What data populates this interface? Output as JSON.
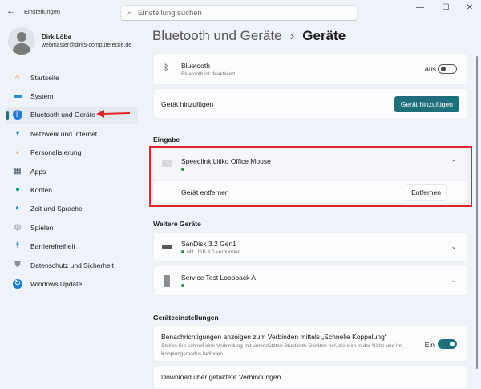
{
  "app": {
    "title": "Einstellungen",
    "back_icon": "arrow-left"
  },
  "search": {
    "placeholder": "Einstellung suchen"
  },
  "window_controls": {
    "minimize": "—",
    "maximize": "☐",
    "close": "✕"
  },
  "user": {
    "name": "Dirk Löbe",
    "email": "webmaster@dirks-computerecke.de"
  },
  "sidebar": {
    "items": [
      {
        "label": "Startseite",
        "icon": "home-icon"
      },
      {
        "label": "System",
        "icon": "system-icon"
      },
      {
        "label": "Bluetooth und Geräte",
        "icon": "bluetooth-icon",
        "active": true
      },
      {
        "label": "Netzwerk und Internet",
        "icon": "wifi-icon"
      },
      {
        "label": "Personalisierung",
        "icon": "brush-icon"
      },
      {
        "label": "Apps",
        "icon": "apps-icon"
      },
      {
        "label": "Konten",
        "icon": "account-icon"
      },
      {
        "label": "Zeit und Sprache",
        "icon": "clock-globe-icon"
      },
      {
        "label": "Spielen",
        "icon": "gamepad-icon"
      },
      {
        "label": "Barrierefreiheit",
        "icon": "accessibility-icon"
      },
      {
        "label": "Datenschutz und Sicherheit",
        "icon": "shield-icon"
      },
      {
        "label": "Windows Update",
        "icon": "update-icon"
      }
    ]
  },
  "breadcrumb": {
    "parent": "Bluetooth und Geräte",
    "sep": "›",
    "current": "Geräte"
  },
  "bluetooth": {
    "title": "Bluetooth",
    "subtitle": "Bluetooth ist deaktiviert.",
    "state": "Aus",
    "on": false
  },
  "add_device": {
    "label": "Gerät hinzufügen",
    "button": "Gerät hinzufügen"
  },
  "input_section": {
    "heading": "Eingabe",
    "device": "Speedlink Litiko Office Mouse",
    "remove_label": "Gerät entfernen",
    "remove_button": "Entfernen"
  },
  "other_section": {
    "heading": "Weitere Geräte",
    "devices": [
      {
        "name": "SanDisk 3.2 Gen1",
        "status": "Mit USB 3.0 verbunden"
      },
      {
        "name": "Service Test Loopback A",
        "status": ""
      }
    ]
  },
  "settings_section": {
    "heading": "Geräteeinstellungen",
    "swift_pair": {
      "title": "Benachrichtigungen anzeigen zum Verbinden mittels „Schnelle Koppelung“",
      "desc": "Stellen Sie schnell eine Verbindung mit unterstützten Bluetooth-Geräten her, die sich in der Nähe und im Kopplungsmodus befinden.",
      "state": "Ein",
      "on": true
    },
    "metered": {
      "title": "Download über getaktete Verbindungen"
    }
  },
  "colors": {
    "accent": "#1f6f7a",
    "highlight": "#e0262a",
    "arrow": "#e0262a"
  }
}
